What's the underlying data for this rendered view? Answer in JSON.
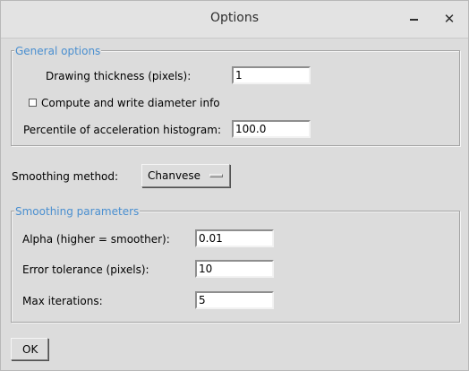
{
  "window": {
    "title": "Options"
  },
  "general": {
    "legend": "General options",
    "drawing_thickness_label": "Drawing thickness (pixels):",
    "drawing_thickness_value": "1",
    "compute_diameter_label": "Compute and write diameter info",
    "compute_diameter_checked": false,
    "percentile_label": "Percentile of acceleration histogram:",
    "percentile_value": "100.0"
  },
  "smoothing": {
    "method_label": "Smoothing method:",
    "method_value": "Chanvese"
  },
  "smoothing_params": {
    "legend": "Smoothing parameters",
    "alpha_label": "Alpha (higher = smoother):",
    "alpha_value": "0.01",
    "error_tolerance_label": "Error tolerance (pixels):",
    "error_tolerance_value": "10",
    "max_iterations_label": "Max iterations:",
    "max_iterations_value": "5"
  },
  "footer": {
    "ok_label": "OK"
  },
  "icons": {
    "minimize": "minimize-icon",
    "close": "close-icon"
  }
}
